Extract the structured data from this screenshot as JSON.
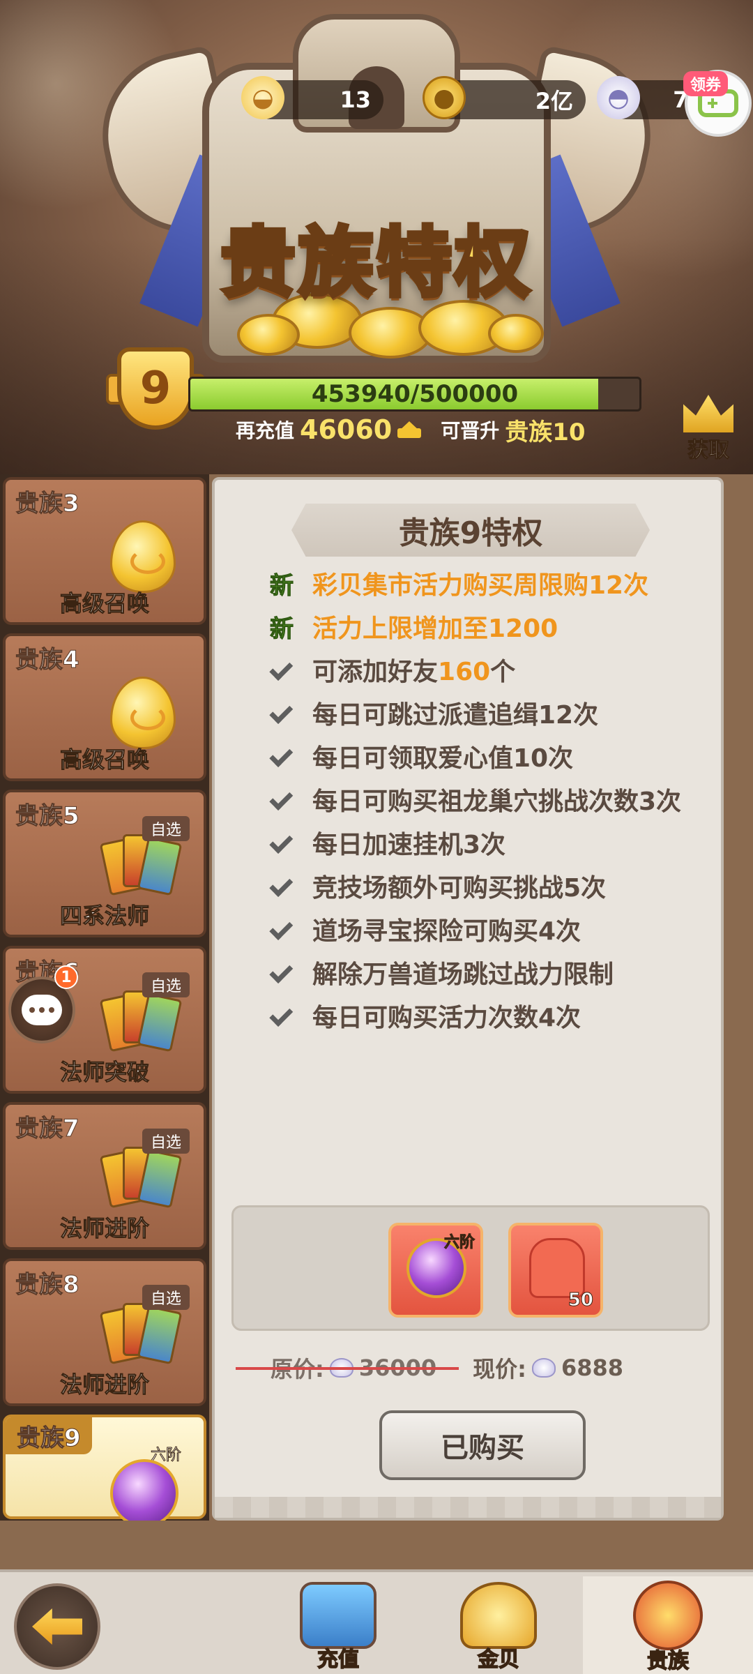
{
  "header": {
    "title": "贵族特权",
    "currencies": {
      "shell": "13",
      "gold": "2亿",
      "pearl": "717"
    },
    "coupon_label": "领券",
    "vip_level": "9",
    "progress_text": "453940/500000",
    "progress_fraction": 0.9079,
    "recharge_label": "再充值",
    "recharge_amount": "46060",
    "upgrade_label": "可晋升",
    "next_tier": "贵族10",
    "get_label": "获取"
  },
  "sidebar": {
    "tiers": [
      {
        "name": "贵族3",
        "reward": "高级召唤"
      },
      {
        "name": "贵族4",
        "reward": "高级召唤"
      },
      {
        "name": "贵族5",
        "reward": "四系法师",
        "tag": "自选"
      },
      {
        "name": "贵族6",
        "reward": "法师突破",
        "tag": "自选"
      },
      {
        "name": "贵族7",
        "reward": "法师进阶",
        "tag": "自选"
      },
      {
        "name": "贵族8",
        "reward": "法师进阶",
        "tag": "自选"
      },
      {
        "name": "贵族9",
        "reward": "",
        "tag": "六阶"
      }
    ],
    "chat_badge": "1"
  },
  "panel": {
    "title": "贵族9特权",
    "new_mark": "新",
    "privileges": [
      {
        "is_new": true,
        "text": "彩贝集市活力购买周限购12次"
      },
      {
        "is_new": true,
        "text": "活力上限增加至1200"
      },
      {
        "is_new": false,
        "pre": "可添加好友",
        "hl": "160",
        "post": "个"
      },
      {
        "is_new": false,
        "text": "每日可跳过派遣追缉12次"
      },
      {
        "is_new": false,
        "text": "每日可领取爱心值10次"
      },
      {
        "is_new": false,
        "text": "每日可购买祖龙巢穴挑战次数3次"
      },
      {
        "is_new": false,
        "text": "每日加速挂机3次"
      },
      {
        "is_new": false,
        "text": "竞技场额外可购买挑战5次"
      },
      {
        "is_new": false,
        "text": "道场寻宝探险可购买4次"
      },
      {
        "is_new": false,
        "text": "解除万兽道场跳过战力限制"
      },
      {
        "is_new": false,
        "text": "每日可购买活力次数4次"
      }
    ],
    "rewards": [
      {
        "grade": "六阶",
        "qty": ""
      },
      {
        "grade": "",
        "qty": "50"
      }
    ],
    "original_price_label": "原价:",
    "original_price": "36000",
    "current_price_label": "现价:",
    "current_price": "6888",
    "buy_button": "已购买"
  },
  "bottom_nav": {
    "tabs": [
      "充值",
      "金贝",
      "贵族"
    ],
    "active": "贵族"
  },
  "colors": {
    "accent_orange": "#f0951d",
    "new_green": "#7cc63a",
    "progress_green": "#8bcb2f"
  }
}
